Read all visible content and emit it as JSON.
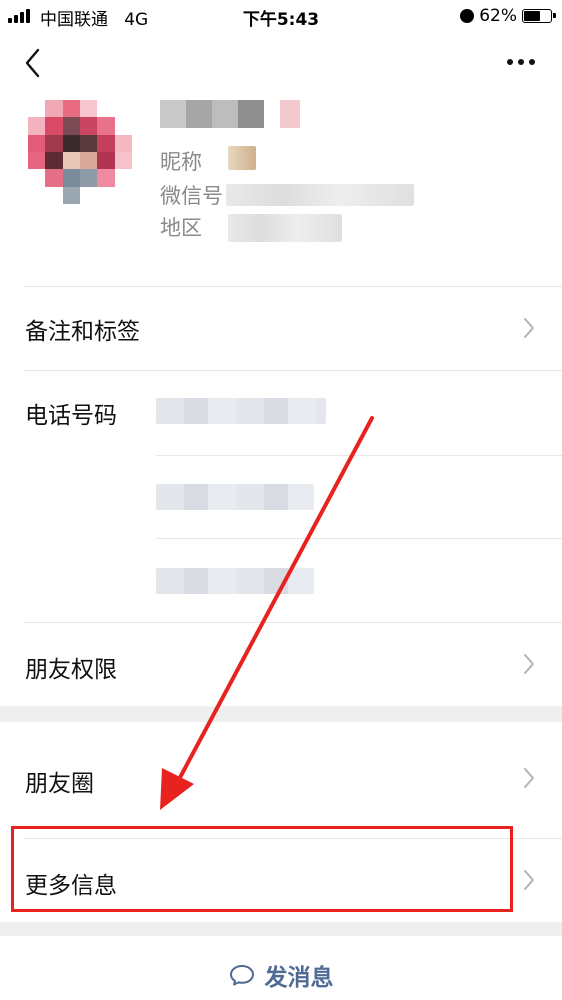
{
  "status_bar": {
    "carrier": "中国联通",
    "network": "4G",
    "time": "下午5:43",
    "battery_percent": "62%",
    "battery_level": 0.62
  },
  "nav": {
    "back_icon": "chevron-left-icon",
    "more_icon": "more-horizontal-icon"
  },
  "profile": {
    "nickname_label": "昵称",
    "wechat_id_label": "微信号",
    "region_label": "地区"
  },
  "rows": {
    "remark_tags": "备注和标签",
    "phone": "电话号码",
    "friend_permissions": "朋友权限",
    "moments": "朋友圈",
    "more_info": "更多信息"
  },
  "send_message": {
    "label": "发消息",
    "icon": "chat-bubble-icon"
  },
  "colors": {
    "highlight": "#e8231f",
    "link": "#4f6a95",
    "section_gap": "#efefef"
  }
}
